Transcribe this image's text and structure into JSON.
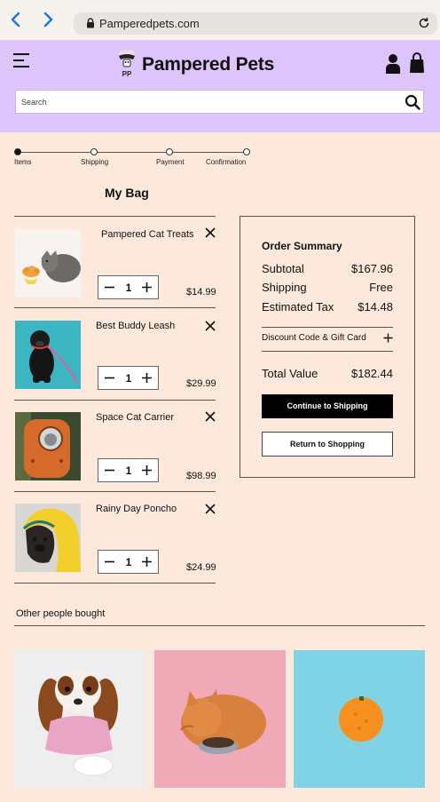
{
  "browser": {
    "url": "Pamperedpets.com",
    "back_icon": "chevron-left-icon",
    "forward_icon": "chevron-right-icon",
    "lock_icon": "lock-icon",
    "reload_icon": "reload-icon",
    "accent": "#1a73e8"
  },
  "header": {
    "brand": "Pampered Pets",
    "logo_letters": "PP",
    "background": "#ddc4fb",
    "search_placeholder": "Search",
    "icons": [
      "hamburger-menu-icon",
      "user-icon",
      "shopping-bag-icon",
      "search-icon"
    ]
  },
  "stepper": {
    "steps": [
      "Items",
      "Shipping",
      "Payment",
      "Confirmation"
    ],
    "active_index": 0
  },
  "bag": {
    "title": "My Bag",
    "items": [
      {
        "name": "Pampered Cat Treats",
        "quantity": "1",
        "price": "$14.99"
      },
      {
        "name": "Best Buddy Leash",
        "quantity": "1",
        "price": "$29.99"
      },
      {
        "name": "Space Cat Carrier",
        "quantity": "1",
        "price": "$98.99"
      },
      {
        "name": "Rainy Day Poncho",
        "quantity": "1",
        "price": "$24.99"
      }
    ]
  },
  "summary": {
    "title": "Order Summary",
    "subtotal_label": "Subtotal",
    "subtotal_value": "$167.96",
    "shipping_label": "Shipping",
    "shipping_value": "Free",
    "tax_label": "Estimated Tax",
    "tax_value": "$14.48",
    "discount_label": "Discount Code & Gift Card",
    "total_label": "Total Value",
    "total_value": "$182.44",
    "continue_label": "Continue to Shipping",
    "return_label": "Return to Shopping"
  },
  "others": {
    "title": "Other people bought"
  },
  "colors": {
    "page_background": "#fde9dc",
    "primary_button": "#000000"
  }
}
